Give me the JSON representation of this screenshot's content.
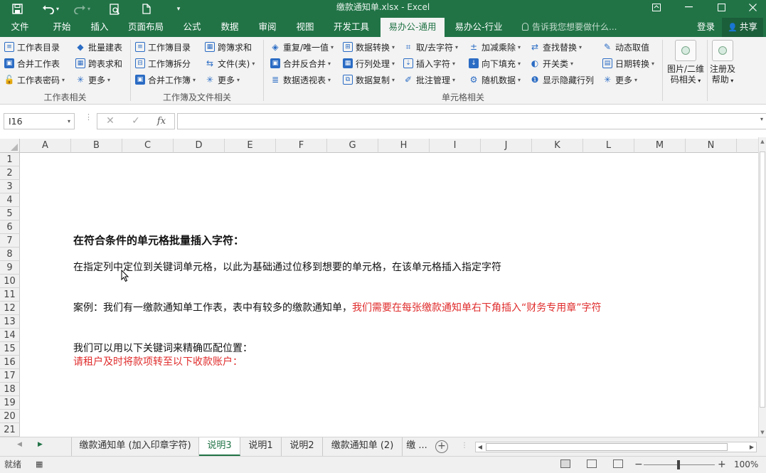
{
  "window": {
    "title": "缴款通知单.xlsx - Excel",
    "quick_access": {
      "save": "save-icon",
      "undo": "undo-icon",
      "redo": "redo-icon",
      "preview": "print-preview-icon",
      "new": "new-file-icon",
      "customize": "customize-icon"
    },
    "controls": {
      "ribbon_options": "ribbon-display-icon",
      "minimize": "minimize-icon",
      "restore": "restore-icon",
      "close": "close-icon"
    }
  },
  "ribbon_tabs": [
    "文件",
    "开始",
    "插入",
    "页面布局",
    "公式",
    "数据",
    "审阅",
    "视图",
    "开发工具",
    "易办公-通用",
    "易办公-行业"
  ],
  "active_tab": "易办公-通用",
  "tell_me": "告诉我您想要做什么...",
  "account": {
    "login": "登录",
    "share": "共享"
  },
  "ribbon": {
    "group1": {
      "label": "工作表相关",
      "items": [
        "工作表目录",
        "批量建表",
        "合并工作表",
        "跨表求和",
        "工作表密码",
        "更多"
      ]
    },
    "group2": {
      "label": "工作簿及文件相关",
      "items": [
        "工作簿目录",
        "跨簿求和",
        "工作簿拆分",
        "文件(夹)",
        "合并工作簿",
        "更多"
      ]
    },
    "group3": {
      "label": "单元格相关",
      "items": [
        "重复/唯一值",
        "数据转换",
        "取/去字符",
        "加减乘除",
        "查找替换",
        "动态取值",
        "合并反合并",
        "行列处理",
        "插入字符",
        "向下填充",
        "开关类",
        "日期转换",
        "数据透视表",
        "数据复制",
        "批注管理",
        "随机数据",
        "显示隐藏行列",
        "更多"
      ]
    },
    "big1": {
      "line1": "图片/二维",
      "line2": "码相关"
    },
    "big2": {
      "line1": "注册及",
      "line2": "帮助"
    }
  },
  "formula_bar": {
    "name_box": "I16",
    "fx": "fx",
    "cancel": "✕",
    "confirm": "✓",
    "value": ""
  },
  "columns": [
    "A",
    "B",
    "C",
    "D",
    "E",
    "F",
    "G",
    "H",
    "I",
    "J",
    "K",
    "L",
    "M",
    "N"
  ],
  "rows": [
    "1",
    "2",
    "3",
    "4",
    "5",
    "6",
    "7",
    "8",
    "9",
    "10",
    "11",
    "12",
    "13",
    "14",
    "15",
    "16",
    "17",
    "18",
    "19",
    "20",
    "21"
  ],
  "cells": {
    "r7": "在符合条件的单元格批量插入字符：",
    "r9": "在指定列中定位到关键词单元格，以此为基础通过位移到想要的单元格，在该单元格插入指定字符",
    "r12_black": "案例：我们有一缴款通知单工作表，表中有较多的缴款通知单，",
    "r12_red": "我们需要在每张缴款通知单右下角插入“财务专用章”字符",
    "r15": "我们可以用以下关键词来精确匹配位置：",
    "r16": "请租户及时将款项转至以下收款账户："
  },
  "sheet_tabs": [
    "缴款通知单 (加入印章字符)",
    "说明3",
    "说明1",
    "说明2",
    "缴款通知单 (2)",
    "缴 ..."
  ],
  "active_sheet": "说明3",
  "status": {
    "ready": "就绪",
    "zoom": "100%"
  },
  "colors": {
    "excel_green": "#217346",
    "red_text": "#e02c2c"
  }
}
